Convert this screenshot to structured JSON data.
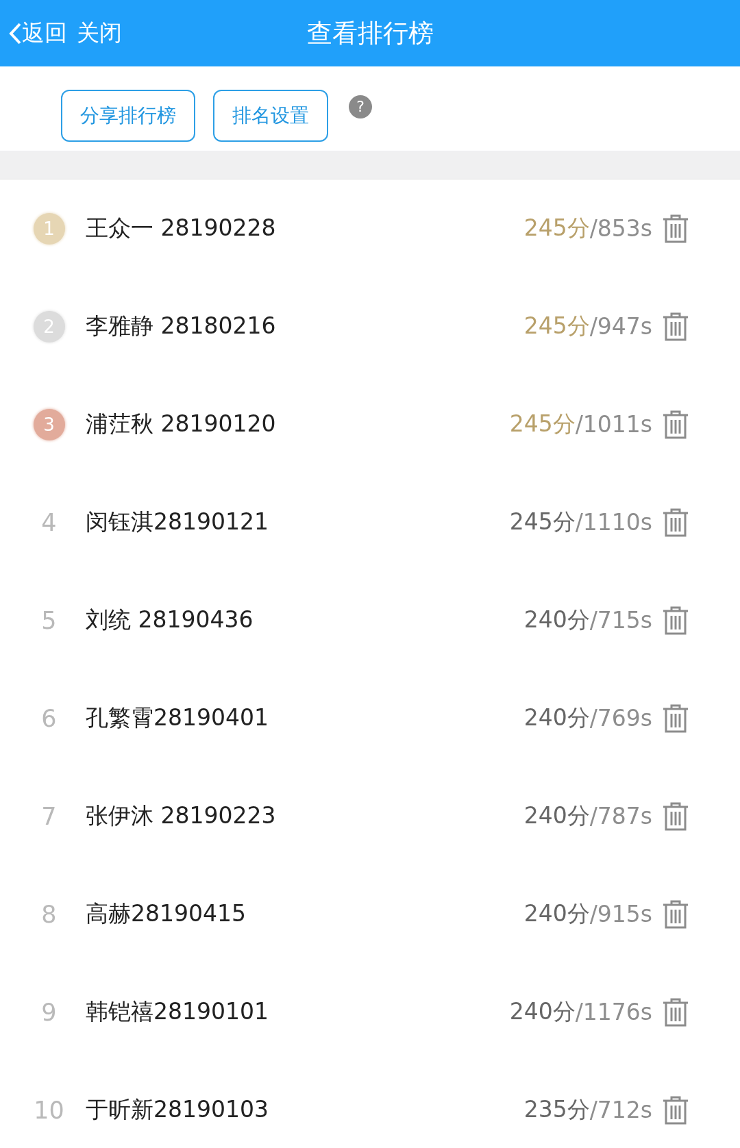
{
  "header": {
    "back": "返回",
    "close": "关闭",
    "title": "查看排行榜"
  },
  "actions": [
    "分享排行榜",
    "排名设置"
  ],
  "help": "?",
  "rows": [
    {
      "kind": "medal",
      "color": "#e6d6b4",
      "rank": "1",
      "name": "王众一 28190228",
      "score": "245分",
      "time": "/853s"
    },
    {
      "kind": "medal",
      "color": "#dcdcdc",
      "rank": "2",
      "name": "李雅静 28180216",
      "score": "245分",
      "time": "/947s"
    },
    {
      "kind": "medal",
      "color": "#e2ab9b",
      "rank": "3",
      "name": "浦茳秋 28190120",
      "score": "245分",
      "time": "/1011s"
    },
    {
      "kind": "plain",
      "rank": "4",
      "name": "闵钰淇28190121",
      "score": "245分",
      "time": "/1110s"
    },
    {
      "kind": "plain",
      "rank": "5",
      "name": "刘统 28190436",
      "score": "240分",
      "time": "/715s"
    },
    {
      "kind": "plain",
      "rank": "6",
      "name": "孔繁霄28190401",
      "score": "240分",
      "time": "/769s"
    },
    {
      "kind": "plain",
      "rank": "7",
      "name": "张伊沐 28190223",
      "score": "240分",
      "time": "/787s"
    },
    {
      "kind": "plain",
      "rank": "8",
      "name": "高赫28190415",
      "score": "240分",
      "time": "/915s"
    },
    {
      "kind": "plain",
      "rank": "9",
      "name": "韩铠禧28190101",
      "score": "240分",
      "time": "/1176s"
    },
    {
      "kind": "plain",
      "rank": "10",
      "name": "于昕新28190103",
      "score": "235分",
      "time": "/712s"
    }
  ]
}
